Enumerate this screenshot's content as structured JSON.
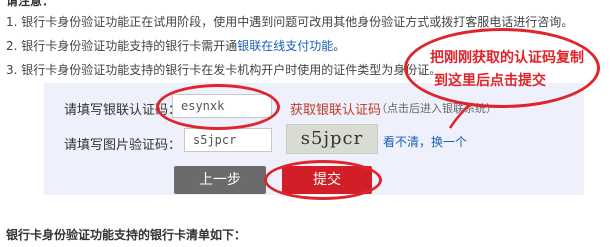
{
  "heading_cut": "请注意：",
  "notes": [
    "1. 银行卡身份验证功能正在试用阶段，使用中遇到问题可改用其他身份验证方式或拨打客服电话进行咨询。",
    "2. 银行卡身份验证功能支持的银行卡需开通",
    "3. 银行卡身份验证功能支持的银行卡在发卡机构开户时使用的证件类型为身份证。"
  ],
  "note2_link": "银联在线支付功能",
  "note2_tail": "。",
  "form": {
    "code_label": "请填写银联认证码：",
    "code_value": "esynxk",
    "get_code_link": "获取银联认证码",
    "hint": "（点击后进入银联系统）",
    "captcha_label": "请填写图片验证码：",
    "captcha_value": "s5jpcr",
    "captcha_image_text": "s5jpcr",
    "refresh_link": "看不清，换一个"
  },
  "buttons": {
    "prev": "上一步",
    "submit": "提交"
  },
  "callout": {
    "line1": "把刚刚获取的认证码复制",
    "line2": "到这里后点击提交"
  },
  "bottom_title": "银行卡身份验证功能支持的银行卡清单如下：",
  "colors": {
    "accent_red": "#e0242b",
    "link_blue": "#1a5fb4",
    "panel_bg": "#eef1fb"
  }
}
